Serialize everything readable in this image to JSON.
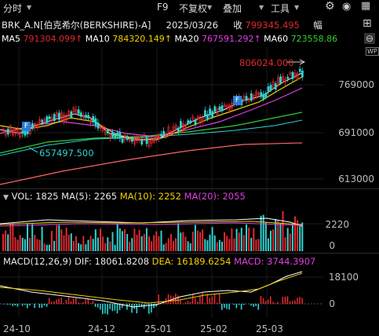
{
  "toolbar": {
    "timeframe": "分时",
    "f9": "F9",
    "adjust": "不复权",
    "overlay": "叠加",
    "tools": "工具"
  },
  "info": {
    "name": "BRK_A.N[伯克希尔(BERKSHIRE)-A]",
    "date": "2025/03/26",
    "close_label": "收",
    "close_value": "799345.495",
    "amp_label": "幅"
  },
  "ma_row": {
    "ma5_label": "MA5",
    "ma5_value": "791304.099",
    "ma10_label": "MA10",
    "ma10_value": "784320.149",
    "ma20_label": "MA20",
    "ma20_value": "767591.292",
    "ma60_label": "MA60",
    "ma60_value": "723558.86"
  },
  "price_axis": [
    "769000",
    "691000",
    "613000"
  ],
  "annotations": {
    "high": "806024.000",
    "low": "657497.500",
    "f_marker": "F"
  },
  "volume": {
    "title": "VOL: 1825",
    "ma5": "MA(5): 2265",
    "ma10": "MA(10): 2252",
    "ma20": "MA(20): 2055",
    "axis": [
      "2220",
      "0"
    ]
  },
  "macd": {
    "title": "MACD(12,26,9)",
    "dif": "DIF: 18061.8208",
    "dea": "DEA: 16189.6254",
    "macd": "MACD: 3744.3907",
    "axis": [
      "18100",
      "0"
    ]
  },
  "x_axis": [
    "24-10",
    "24-12",
    "25-01",
    "25-02",
    "25-03"
  ],
  "colors": {
    "up": "#e0282e",
    "down": "#2fd2d2",
    "ma5": "#ffffff",
    "ma10": "#f0d000",
    "ma20": "#e040e0",
    "ma60": "#33cc33",
    "long": "#ff6464",
    "fmarker": "#2a7cd6"
  }
}
